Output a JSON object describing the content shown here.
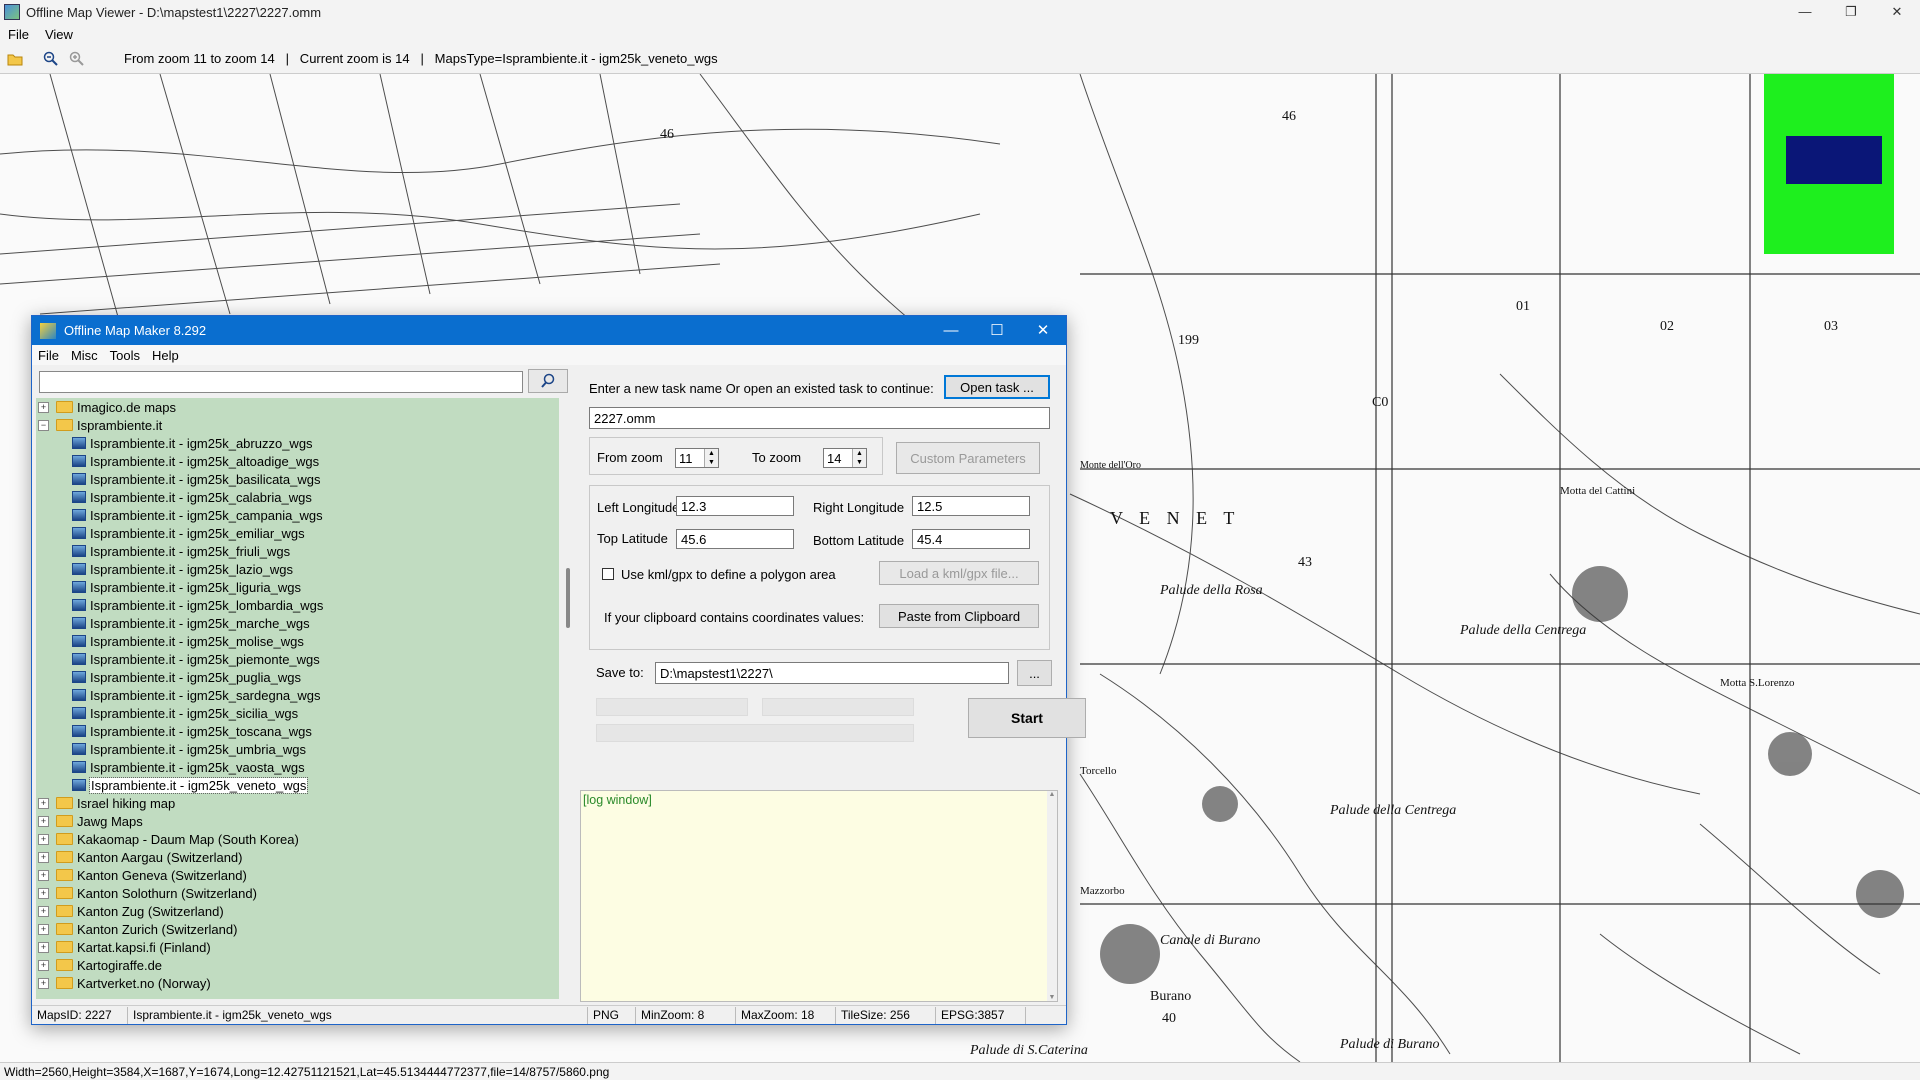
{
  "app": {
    "title": "Offline Map Viewer - D:\\mapstest1\\2227\\2227.omm",
    "menu": [
      "File",
      "View"
    ],
    "toolbar": {
      "zoom_range": "From zoom 11 to zoom 14   |   Current zoom is 14   |   MapsType=Isprambiente.it - igm25k_veneto_wgs"
    },
    "status": "Width=2560,Height=3584,X=1687,Y=1674,Long=12.42751121521,Lat=45.5134444772377,file=14/8757/5860.png",
    "map_labels": [
      "46",
      "46",
      "01",
      "02",
      "03",
      "199",
      "C0",
      "43",
      "V E N E T",
      "Palude della Rosa",
      "Palude della Centrega",
      "Palude della Centrega",
      "Canale di Burano",
      "Burano",
      "40",
      "Palude di S.Caterina",
      "Palude di Burano",
      "Motta del Cattini",
      "Motta S.Lorenzo",
      "Monte dell'Oro",
      "Torcello",
      "Mazzorbo"
    ]
  },
  "omm": {
    "title": "Offline Map Maker 8.292",
    "menu": [
      "File",
      "Misc",
      "Tools",
      "Help"
    ],
    "search": {
      "value": "",
      "placeholder": ""
    },
    "tree": [
      {
        "label": "Imagico.de maps",
        "type": "folder",
        "expanded": false
      },
      {
        "label": "Isprambiente.it",
        "type": "folder",
        "expanded": true
      },
      {
        "label": "Isprambiente.it - igm25k_abruzzo_wgs",
        "type": "map"
      },
      {
        "label": "Isprambiente.it - igm25k_altoadige_wgs",
        "type": "map"
      },
      {
        "label": "Isprambiente.it - igm25k_basilicata_wgs",
        "type": "map"
      },
      {
        "label": "Isprambiente.it - igm25k_calabria_wgs",
        "type": "map"
      },
      {
        "label": "Isprambiente.it - igm25k_campania_wgs",
        "type": "map"
      },
      {
        "label": "Isprambiente.it - igm25k_emiliar_wgs",
        "type": "map"
      },
      {
        "label": "Isprambiente.it - igm25k_friuli_wgs",
        "type": "map"
      },
      {
        "label": "Isprambiente.it - igm25k_lazio_wgs",
        "type": "map"
      },
      {
        "label": "Isprambiente.it - igm25k_liguria_wgs",
        "type": "map"
      },
      {
        "label": "Isprambiente.it - igm25k_lombardia_wgs",
        "type": "map"
      },
      {
        "label": "Isprambiente.it - igm25k_marche_wgs",
        "type": "map"
      },
      {
        "label": "Isprambiente.it - igm25k_molise_wgs",
        "type": "map"
      },
      {
        "label": "Isprambiente.it - igm25k_piemonte_wgs",
        "type": "map"
      },
      {
        "label": "Isprambiente.it - igm25k_puglia_wgs",
        "type": "map"
      },
      {
        "label": "Isprambiente.it - igm25k_sardegna_wgs",
        "type": "map"
      },
      {
        "label": "Isprambiente.it - igm25k_sicilia_wgs",
        "type": "map"
      },
      {
        "label": "Isprambiente.it - igm25k_toscana_wgs",
        "type": "map"
      },
      {
        "label": "Isprambiente.it - igm25k_umbria_wgs",
        "type": "map"
      },
      {
        "label": "Isprambiente.it - igm25k_vaosta_wgs",
        "type": "map"
      },
      {
        "label": "Isprambiente.it - igm25k_veneto_wgs",
        "type": "map",
        "selected": true
      },
      {
        "label": "Israel hiking map",
        "type": "folder",
        "expanded": false
      },
      {
        "label": "Jawg Maps",
        "type": "folder",
        "expanded": false
      },
      {
        "label": "Kakaomap - Daum Map (South Korea)",
        "type": "folder",
        "expanded": false
      },
      {
        "label": "Kanton Aargau (Switzerland)",
        "type": "folder",
        "expanded": false
      },
      {
        "label": "Kanton Geneva (Switzerland)",
        "type": "folder",
        "expanded": false
      },
      {
        "label": "Kanton Solothurn (Switzerland)",
        "type": "folder",
        "expanded": false
      },
      {
        "label": "Kanton Zug (Switzerland)",
        "type": "folder",
        "expanded": false
      },
      {
        "label": "Kanton Zurich (Switzerland)",
        "type": "folder",
        "expanded": false
      },
      {
        "label": "Kartat.kapsi.fi (Finland)",
        "type": "folder",
        "expanded": false
      },
      {
        "label": "Kartogiraffe.de",
        "type": "folder",
        "expanded": false
      },
      {
        "label": "Kartverket.no (Norway)",
        "type": "folder",
        "expanded": false
      }
    ],
    "task_prompt": "Enter a new task name Or open an existed task to continue:",
    "open_task_label": "Open task ...",
    "task_name": "2227.omm",
    "from_zoom_label": "From zoom",
    "from_zoom": "11",
    "to_zoom_label": "To zoom",
    "to_zoom": "14",
    "custom_params_label": "Custom Parameters",
    "left_lon_label": "Left Longitude",
    "left_lon": "12.3",
    "right_lon_label": "Right Longitude",
    "right_lon": "12.5",
    "top_lat_label": "Top Latitude",
    "top_lat": "45.6",
    "bottom_lat_label": "Bottom Latitude",
    "bottom_lat": "45.4",
    "kml_label": "Use kml/gpx to define a polygon area",
    "load_kml_label": "Load a kml/gpx file...",
    "clipboard_label": "If your clipboard contains coordinates values:",
    "paste_label": "Paste from Clipboard",
    "save_to_label": "Save to:",
    "save_to": "D:\\mapstest1\\2227\\",
    "browse_label": "...",
    "start_label": "Start",
    "log_text": "[log window]",
    "status": {
      "maps_id": "MapsID: 2227",
      "map_name": "Isprambiente.it - igm25k_veneto_wgs",
      "format": "PNG",
      "min_zoom": "MinZoom: 8",
      "max_zoom": "MaxZoom: 18",
      "tile_size": "TileSize: 256",
      "epsg": "EPSG:3857"
    }
  },
  "colors": {
    "omm_titlebar": "#0a6ecf",
    "tree_bg": "#c1dcc1",
    "log_bg": "#fdfde3",
    "overview_green": "#1eef1e",
    "overview_blue": "#0a1677"
  }
}
